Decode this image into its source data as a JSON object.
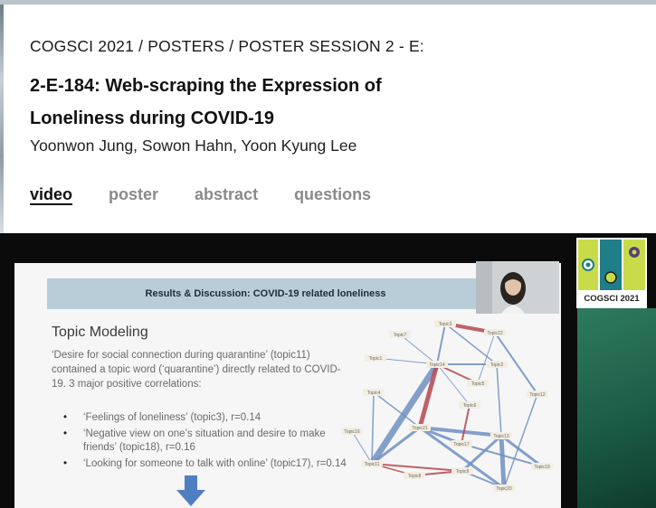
{
  "header": {
    "breadcrumb": "COGSCI 2021 / POSTERS / POSTER SESSION 2 - E:",
    "title": "2-E-184: Web-scraping the Expression of Loneliness during COVID-19",
    "authors": "Yoonwon Jung, Sowon Hahn, Yoon Kyung Lee"
  },
  "tabs": [
    {
      "label": "video",
      "active": true
    },
    {
      "label": "poster",
      "active": false
    },
    {
      "label": "abstract",
      "active": false
    },
    {
      "label": "questions",
      "active": false
    }
  ],
  "slide": {
    "banner": "Results & Discussion: COVID-19 related loneliness",
    "heading": "Topic Modeling",
    "body": "‘Desire for social connection during quarantine’ (topic11) contained a topic word (‘quarantine’) directly related to COVID-19. 3 major positive correlations:",
    "bullets": [
      "‘Feelings of loneliness’ (topic3), r=0.14",
      "‘Negative view on one’s situation and desire to make friends’ (topic18), r=0.16",
      "‘Looking for someone to talk with online’ (topic17), r=0.14"
    ],
    "network_nodes": [
      "Topic3",
      "Topic22",
      "Topic7",
      "Topic1",
      "Topic14",
      "Topic2",
      "Topic5",
      "Topic4",
      "Topic12",
      "Topic6",
      "Topic21",
      "Topic16",
      "Topic13",
      "Topic17",
      "Topic11",
      "Topic19",
      "Topic9",
      "Topic8",
      "Topic20"
    ]
  },
  "logo": {
    "text": "COGSCI 2021"
  },
  "colors": {
    "banner": "#b8cdd7",
    "positive_edge": "#6e8fc2",
    "negative_edge": "#b5474f",
    "logo_lime": "#c8dc4a",
    "logo_teal": "#1f7e87"
  }
}
